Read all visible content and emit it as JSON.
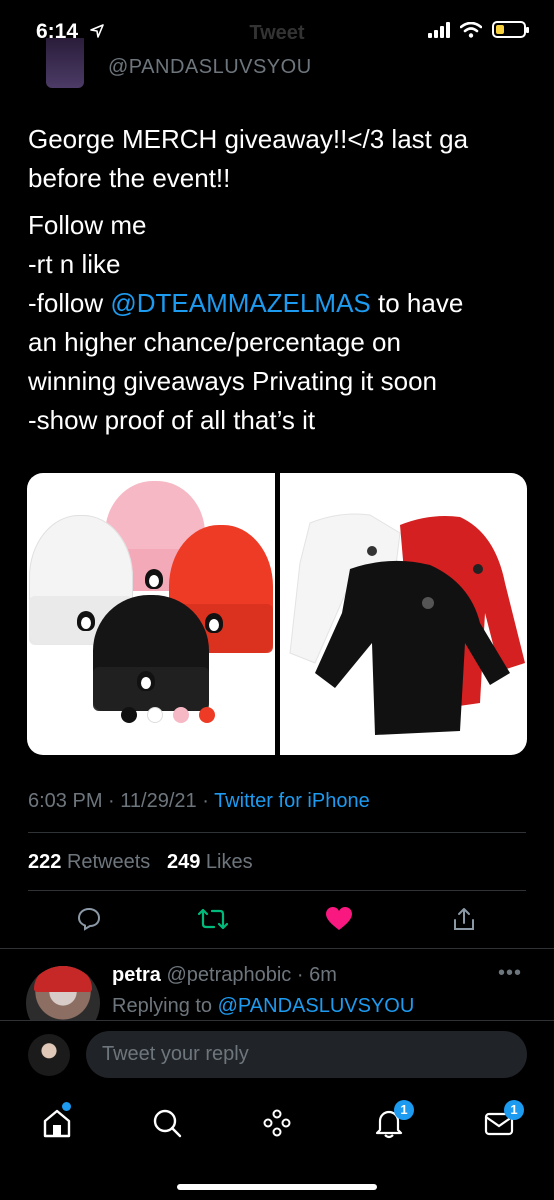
{
  "status_bar": {
    "time": "6:14",
    "location_arrow": "➤"
  },
  "header": {
    "title": "Tweet"
  },
  "tweet": {
    "handle": "@PANDASLUVSYOU",
    "text_para1": "George MERCH giveaway!!</3 last ga before the event!!",
    "text_lines1": [
      "George MERCH giveaway!!</3 last ga",
      "before the event!!"
    ],
    "text_lines2_pre": "Follow me",
    "text_line3": "-rt n like",
    "text_line4_pre": "-follow ",
    "text_line4_mention": "@DTEAMMAZELMAS",
    "text_line4_post": " to have",
    "text_line5": "an higher chance/percentage on",
    "text_line6": "winning giveaways Privating it soon",
    "text_line7": "-show proof of all that’s it",
    "time": "6:03 PM",
    "sep1": " · ",
    "date": "11/29/21",
    "sep2": " · ",
    "source": "Twitter for iPhone",
    "retweets_count": "222",
    "retweets_label": "Retweets",
    "likes_count": "249",
    "likes_label": "Likes"
  },
  "reply": {
    "name": "petra",
    "handle": "@petraphobic",
    "sep": " · ",
    "time": "6m",
    "more": "•••",
    "replying_prefix": "Replying to ",
    "replying_to": "@PANDASLUVSYOU"
  },
  "compose": {
    "placeholder": "Tweet your reply"
  },
  "tabbar": {
    "notifications_badge": "1",
    "messages_badge": "1"
  },
  "colors": {
    "accent": "#1d9bf0",
    "like": "#f91880",
    "retweet": "#00ba7c",
    "background": "#000000"
  },
  "icons": [
    "home-icon",
    "search-icon",
    "spaces-icon",
    "bell-icon",
    "mail-icon",
    "reply-icon",
    "retweet-icon",
    "heart-icon",
    "share-icon"
  ]
}
